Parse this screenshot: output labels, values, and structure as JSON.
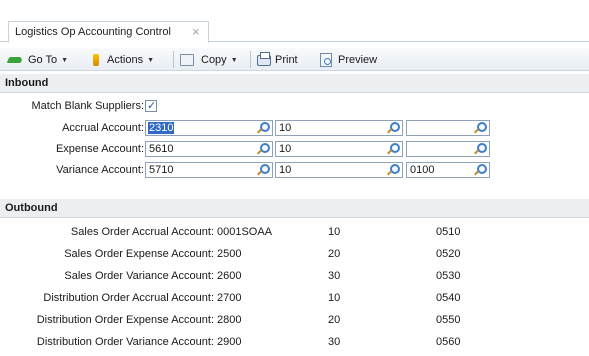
{
  "tab": {
    "title": "Logistics Op Accounting Control",
    "close": "×"
  },
  "toolbar": {
    "goto_label": "Go To",
    "actions_label": "Actions",
    "copy_label": "Copy",
    "print_label": "Print",
    "preview_label": "Preview"
  },
  "inbound": {
    "title": "Inbound",
    "match_blank_suppliers_label": "Match Blank Suppliers:",
    "match_blank_suppliers_checked": true,
    "rows": [
      {
        "label": "Accrual Account:",
        "field1": "2310",
        "field2": "10",
        "field3": ""
      },
      {
        "label": "Expense Account:",
        "field1": "5610",
        "field2": "10",
        "field3": ""
      },
      {
        "label": "Variance Account:",
        "field1": "5710",
        "field2": "10",
        "field3": "0100"
      }
    ]
  },
  "outbound": {
    "title": "Outbound",
    "rows": [
      {
        "label": "Sales Order Accrual Account:",
        "account": "0001SOAA",
        "col2": "10",
        "col3": "0510"
      },
      {
        "label": "Sales Order Expense Account:",
        "account": "2500",
        "col2": "20",
        "col3": "0520"
      },
      {
        "label": "Sales Order Variance Account:",
        "account": "2600",
        "col2": "30",
        "col3": "0530"
      },
      {
        "label": "Distribution Order Accrual Account:",
        "account": "2700",
        "col2": "10",
        "col3": "0540"
      },
      {
        "label": "Distribution Order Expense Account:",
        "account": "2800",
        "col2": "20",
        "col3": "0550"
      },
      {
        "label": "Distribution Order Variance Account:",
        "account": "2900",
        "col2": "30",
        "col3": "0560"
      }
    ]
  },
  "colors": {
    "selection": "#3169c6",
    "section_bg": "#eceff2",
    "field_border": "#8fa3b8"
  },
  "icons": [
    "goto-icon",
    "actions-icon",
    "copy-icon",
    "print-icon",
    "preview-icon",
    "lookup-icon",
    "close-icon"
  ]
}
